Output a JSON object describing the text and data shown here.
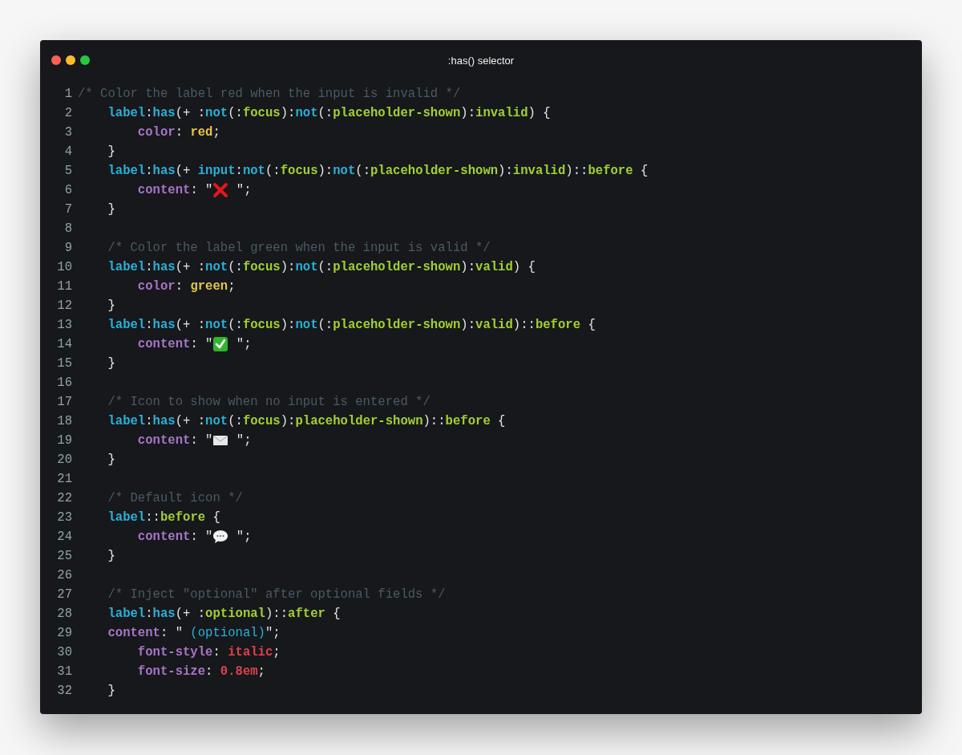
{
  "window": {
    "title": ":has() selector"
  },
  "code": {
    "lines": [
      {
        "number": "1",
        "tokens": [
          {
            "text": "/* Color the label red when the input is invalid */",
            "kind": "comment"
          }
        ]
      },
      {
        "number": "2",
        "tokens": [
          {
            "text": "    label",
            "kind": "tag"
          },
          {
            "text": ":",
            "kind": "punct"
          },
          {
            "text": "has",
            "kind": "fn"
          },
          {
            "text": "(+ :",
            "kind": "punct"
          },
          {
            "text": "not",
            "kind": "fn"
          },
          {
            "text": "(:",
            "kind": "punct"
          },
          {
            "text": "focus",
            "kind": "pseudo"
          },
          {
            "text": "):",
            "kind": "punct"
          },
          {
            "text": "not",
            "kind": "fn"
          },
          {
            "text": "(:",
            "kind": "punct"
          },
          {
            "text": "placeholder-shown",
            "kind": "pseudo"
          },
          {
            "text": "):",
            "kind": "punct"
          },
          {
            "text": "invalid",
            "kind": "pseudo"
          },
          {
            "text": ") {",
            "kind": "punct"
          }
        ]
      },
      {
        "number": "3",
        "tokens": [
          {
            "text": "        color",
            "kind": "prop"
          },
          {
            "text": ": ",
            "kind": "punct"
          },
          {
            "text": "red",
            "kind": "value"
          },
          {
            "text": ";",
            "kind": "punct"
          }
        ]
      },
      {
        "number": "4",
        "tokens": [
          {
            "text": "    }",
            "kind": "punct"
          }
        ]
      },
      {
        "number": "5",
        "tokens": [
          {
            "text": "    label",
            "kind": "tag"
          },
          {
            "text": ":",
            "kind": "punct"
          },
          {
            "text": "has",
            "kind": "fn"
          },
          {
            "text": "(+ ",
            "kind": "punct"
          },
          {
            "text": "input",
            "kind": "tag"
          },
          {
            "text": ":",
            "kind": "punct"
          },
          {
            "text": "not",
            "kind": "fn"
          },
          {
            "text": "(:",
            "kind": "punct"
          },
          {
            "text": "focus",
            "kind": "pseudo"
          },
          {
            "text": "):",
            "kind": "punct"
          },
          {
            "text": "not",
            "kind": "fn"
          },
          {
            "text": "(:",
            "kind": "punct"
          },
          {
            "text": "placeholder-shown",
            "kind": "pseudo"
          },
          {
            "text": "):",
            "kind": "punct"
          },
          {
            "text": "invalid",
            "kind": "pseudo"
          },
          {
            "text": ")::",
            "kind": "punct"
          },
          {
            "text": "before",
            "kind": "pseudo"
          },
          {
            "text": " {",
            "kind": "punct"
          }
        ]
      },
      {
        "number": "6",
        "tokens": [
          {
            "text": "        content",
            "kind": "prop"
          },
          {
            "text": ": \"",
            "kind": "punct"
          },
          {
            "kind": "cross"
          },
          {
            "text": " \";",
            "kind": "punct"
          }
        ]
      },
      {
        "number": "7",
        "tokens": [
          {
            "text": "    }",
            "kind": "punct"
          }
        ]
      },
      {
        "number": "8"
      },
      {
        "number": "9",
        "tokens": [
          {
            "text": "    /* Color the label green when the input is valid */",
            "kind": "comment"
          }
        ]
      },
      {
        "number": "10",
        "tokens": [
          {
            "text": "    label",
            "kind": "tag"
          },
          {
            "text": ":",
            "kind": "punct"
          },
          {
            "text": "has",
            "kind": "fn"
          },
          {
            "text": "(+ :",
            "kind": "punct"
          },
          {
            "text": "not",
            "kind": "fn"
          },
          {
            "text": "(:",
            "kind": "punct"
          },
          {
            "text": "focus",
            "kind": "pseudo"
          },
          {
            "text": "):",
            "kind": "punct"
          },
          {
            "text": "not",
            "kind": "fn"
          },
          {
            "text": "(:",
            "kind": "punct"
          },
          {
            "text": "placeholder-shown",
            "kind": "pseudo"
          },
          {
            "text": "):",
            "kind": "punct"
          },
          {
            "text": "valid",
            "kind": "pseudo"
          },
          {
            "text": ") {",
            "kind": "punct"
          }
        ]
      },
      {
        "number": "11",
        "tokens": [
          {
            "text": "        color",
            "kind": "prop"
          },
          {
            "text": ": ",
            "kind": "punct"
          },
          {
            "text": "green",
            "kind": "value"
          },
          {
            "text": ";",
            "kind": "punct"
          }
        ]
      },
      {
        "number": "12",
        "tokens": [
          {
            "text": "    }",
            "kind": "punct"
          }
        ]
      },
      {
        "number": "13",
        "tokens": [
          {
            "text": "    label",
            "kind": "tag"
          },
          {
            "text": ":",
            "kind": "punct"
          },
          {
            "text": "has",
            "kind": "fn"
          },
          {
            "text": "(+ :",
            "kind": "punct"
          },
          {
            "text": "not",
            "kind": "fn"
          },
          {
            "text": "(:",
            "kind": "punct"
          },
          {
            "text": "focus",
            "kind": "pseudo"
          },
          {
            "text": "):",
            "kind": "punct"
          },
          {
            "text": "not",
            "kind": "fn"
          },
          {
            "text": "(:",
            "kind": "punct"
          },
          {
            "text": "placeholder-shown",
            "kind": "pseudo"
          },
          {
            "text": "):",
            "kind": "punct"
          },
          {
            "text": "valid",
            "kind": "pseudo"
          },
          {
            "text": ")::",
            "kind": "punct"
          },
          {
            "text": "before",
            "kind": "pseudo"
          },
          {
            "text": " {",
            "kind": "punct"
          }
        ]
      },
      {
        "number": "14",
        "tokens": [
          {
            "text": "        content",
            "kind": "prop"
          },
          {
            "text": ": \"",
            "kind": "punct"
          },
          {
            "kind": "check"
          },
          {
            "text": " \";",
            "kind": "punct"
          }
        ]
      },
      {
        "number": "15",
        "tokens": [
          {
            "text": "    }",
            "kind": "punct"
          }
        ]
      },
      {
        "number": "16"
      },
      {
        "number": "17",
        "tokens": [
          {
            "text": "    /* Icon to show when no input is entered */",
            "kind": "comment"
          }
        ]
      },
      {
        "number": "18",
        "tokens": [
          {
            "text": "    label",
            "kind": "tag"
          },
          {
            "text": ":",
            "kind": "punct"
          },
          {
            "text": "has",
            "kind": "fn"
          },
          {
            "text": "(+ :",
            "kind": "punct"
          },
          {
            "text": "not",
            "kind": "fn"
          },
          {
            "text": "(:",
            "kind": "punct"
          },
          {
            "text": "focus",
            "kind": "pseudo"
          },
          {
            "text": "):",
            "kind": "punct"
          },
          {
            "text": "placeholder-shown",
            "kind": "pseudo"
          },
          {
            "text": ")::",
            "kind": "punct"
          },
          {
            "text": "before",
            "kind": "pseudo"
          },
          {
            "text": " {",
            "kind": "punct"
          }
        ]
      },
      {
        "number": "19",
        "tokens": [
          {
            "text": "        content",
            "kind": "prop"
          },
          {
            "text": ": \"",
            "kind": "punct"
          },
          {
            "kind": "envelope"
          },
          {
            "text": " \";",
            "kind": "punct"
          }
        ]
      },
      {
        "number": "20",
        "tokens": [
          {
            "text": "    }",
            "kind": "punct"
          }
        ]
      },
      {
        "number": "21"
      },
      {
        "number": "22",
        "tokens": [
          {
            "text": "    /* Default icon */",
            "kind": "comment"
          }
        ]
      },
      {
        "number": "23",
        "tokens": [
          {
            "text": "    label",
            "kind": "tag"
          },
          {
            "text": "::",
            "kind": "punct"
          },
          {
            "text": "before",
            "kind": "pseudo"
          },
          {
            "text": " {",
            "kind": "punct"
          }
        ]
      },
      {
        "number": "24",
        "tokens": [
          {
            "text": "        content",
            "kind": "prop"
          },
          {
            "text": ": \"",
            "kind": "punct"
          },
          {
            "kind": "bubble"
          },
          {
            "text": " \";",
            "kind": "punct"
          }
        ]
      },
      {
        "number": "25",
        "tokens": [
          {
            "text": "    }",
            "kind": "punct"
          }
        ]
      },
      {
        "number": "26"
      },
      {
        "number": "27",
        "tokens": [
          {
            "text": "    /* Inject \"optional\" after optional fields */",
            "kind": "comment"
          }
        ]
      },
      {
        "number": "28",
        "tokens": [
          {
            "text": "    label",
            "kind": "tag"
          },
          {
            "text": ":",
            "kind": "punct"
          },
          {
            "text": "has",
            "kind": "fn"
          },
          {
            "text": "(+ :",
            "kind": "punct"
          },
          {
            "text": "optional",
            "kind": "pseudo"
          },
          {
            "text": ")::",
            "kind": "punct"
          },
          {
            "text": "after",
            "kind": "pseudo"
          },
          {
            "text": " {",
            "kind": "punct"
          }
        ]
      },
      {
        "number": "29",
        "tokens": [
          {
            "text": "    content",
            "kind": "prop"
          },
          {
            "text": ": \"",
            "kind": "punct"
          },
          {
            "text": " (optional)",
            "kind": "string"
          },
          {
            "text": "\";",
            "kind": "punct"
          }
        ]
      },
      {
        "number": "30",
        "tokens": [
          {
            "text": "        font-style",
            "kind": "prop"
          },
          {
            "text": ": ",
            "kind": "punct"
          },
          {
            "text": "italic",
            "kind": "number"
          },
          {
            "text": ";",
            "kind": "punct"
          }
        ]
      },
      {
        "number": "31",
        "tokens": [
          {
            "text": "        font-size",
            "kind": "prop"
          },
          {
            "text": ": ",
            "kind": "punct"
          },
          {
            "text": "0.8em",
            "kind": "number"
          },
          {
            "text": ";",
            "kind": "punct"
          }
        ]
      },
      {
        "number": "32",
        "tokens": [
          {
            "text": "    }",
            "kind": "punct"
          }
        ]
      }
    ]
  }
}
